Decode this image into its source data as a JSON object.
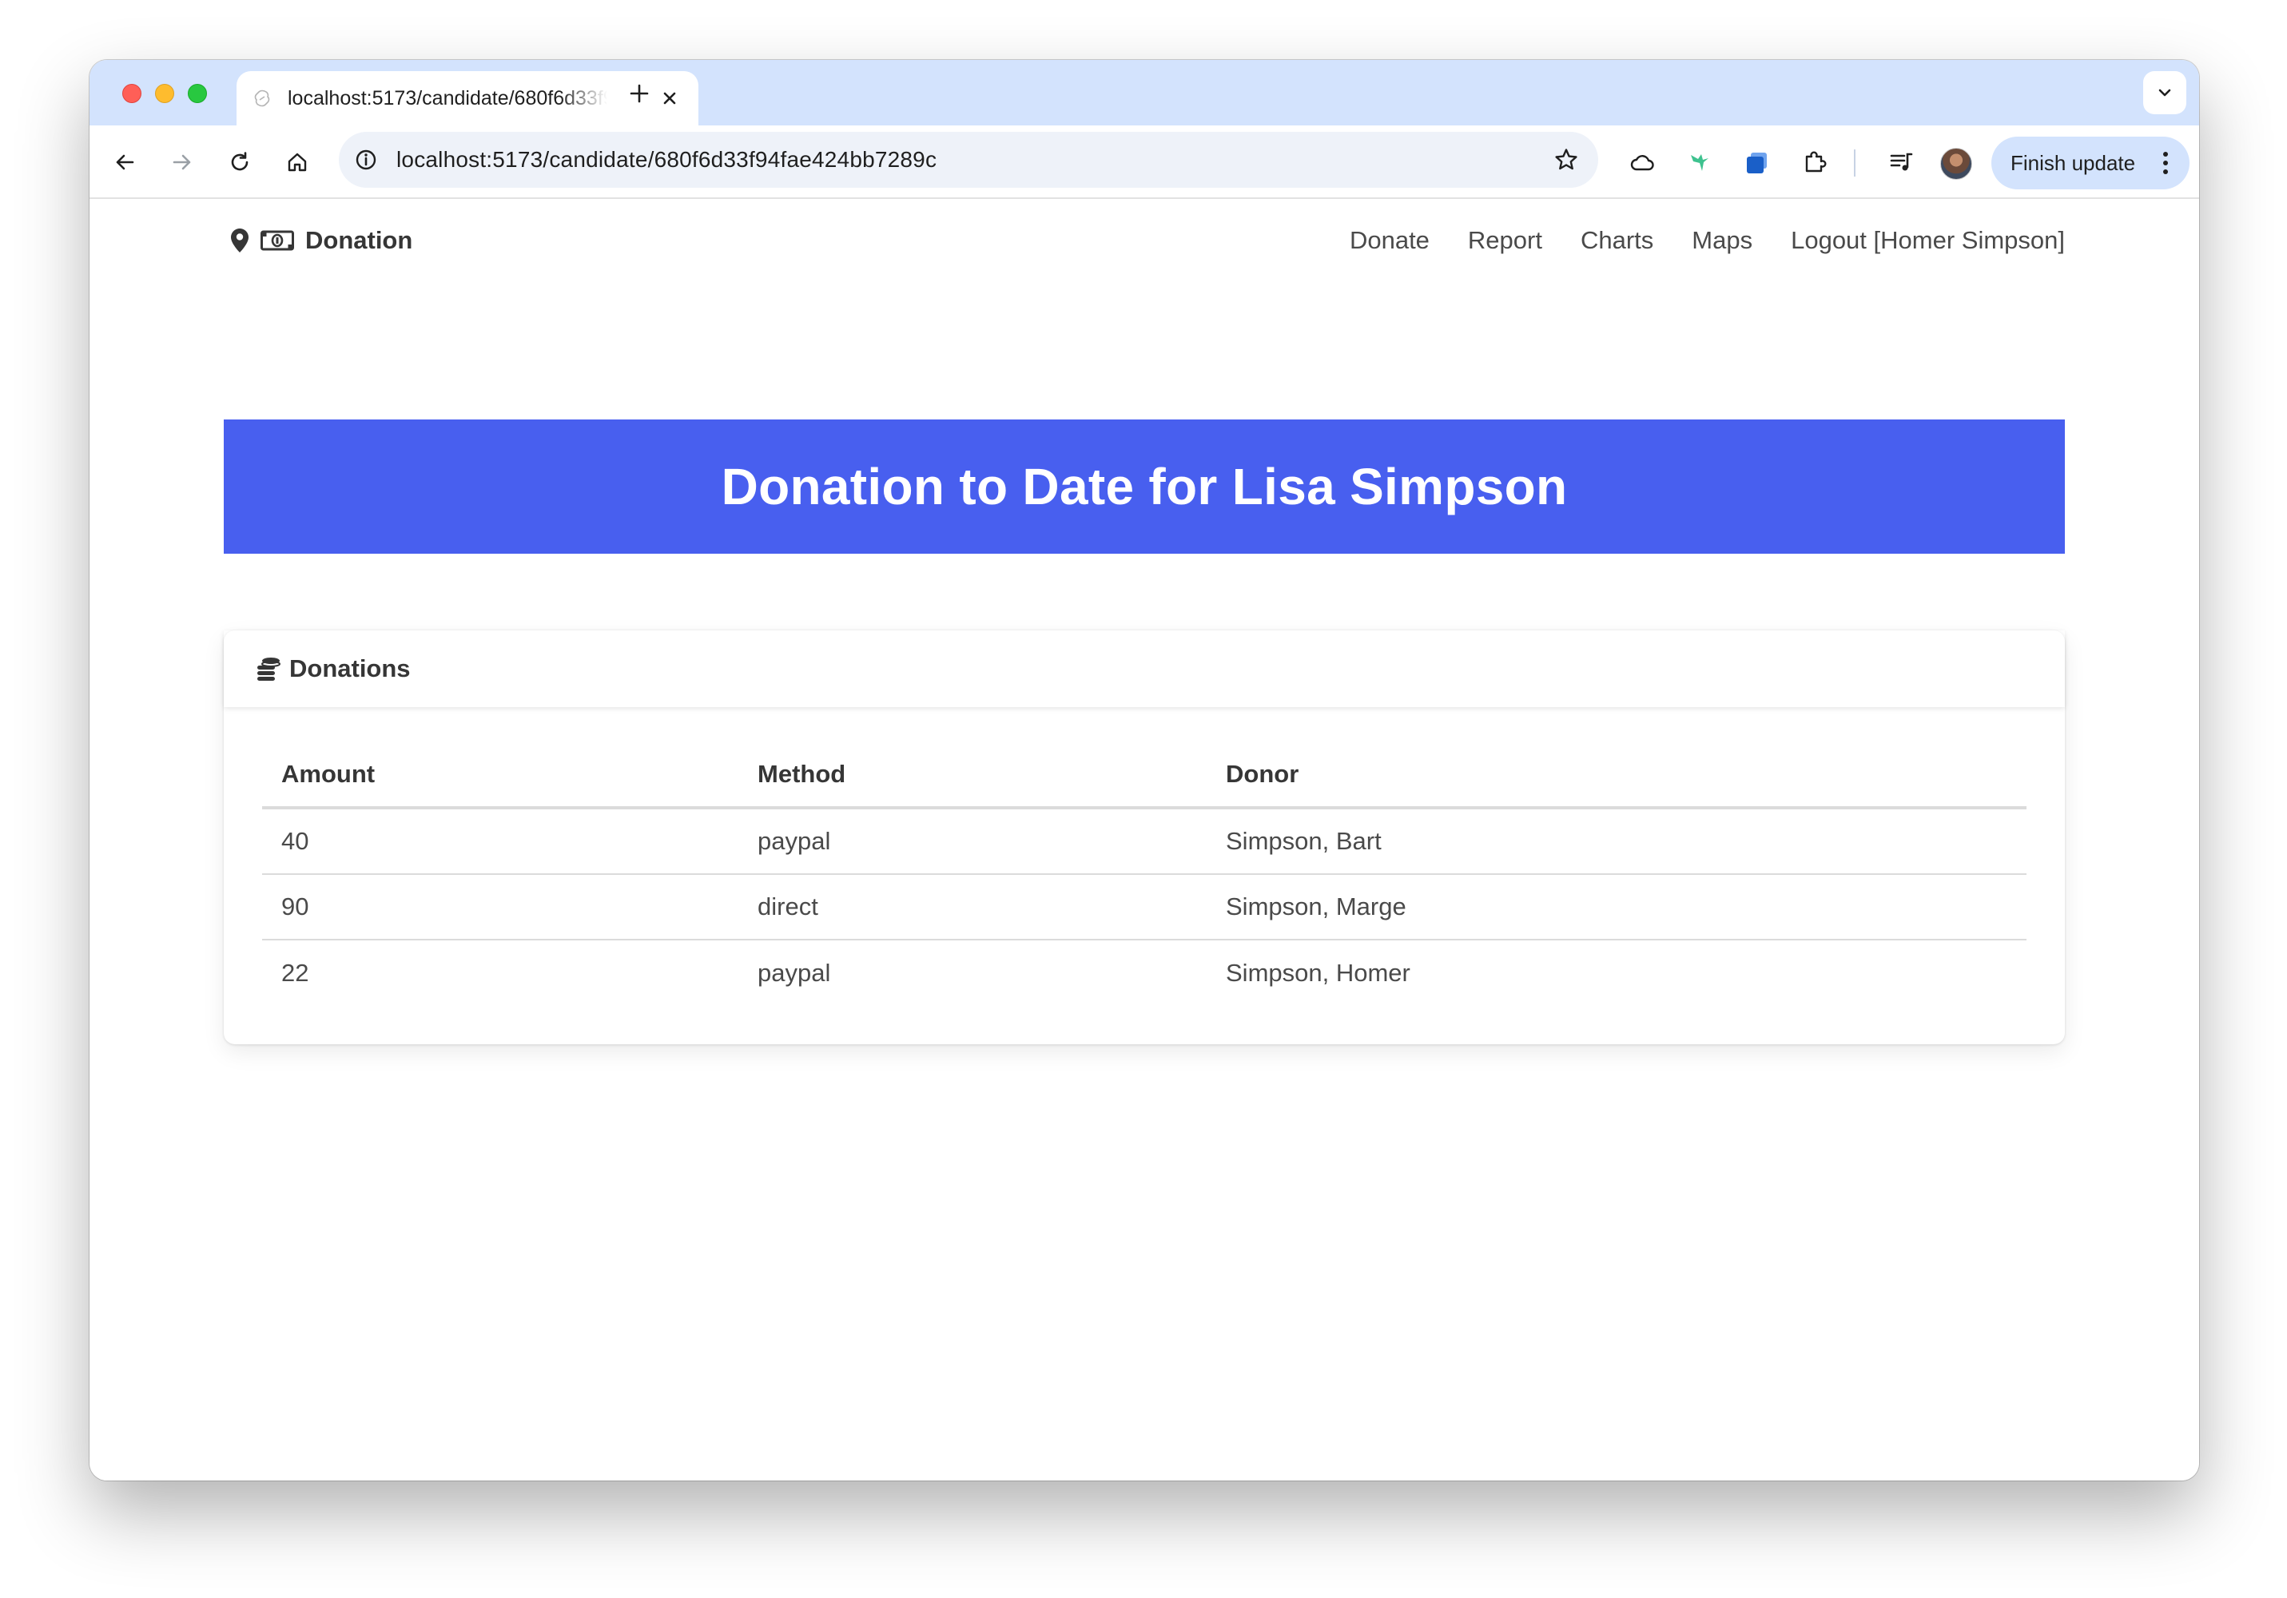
{
  "browser": {
    "tab_title": "localhost:5173/candidate/680f6d33f94fae424bb7289c",
    "url": "localhost:5173/candidate/680f6d33f94fae424bb7289c",
    "finish_update_label": "Finish update"
  },
  "navbar": {
    "brand": "Donation",
    "links": [
      "Donate",
      "Report",
      "Charts",
      "Maps",
      "Logout [Homer Simpson]"
    ]
  },
  "hero": {
    "title": "Donation to Date for Lisa Simpson",
    "color": "#485fef"
  },
  "donations": {
    "title": "Donations",
    "columns": [
      "Amount",
      "Method",
      "Donor"
    ],
    "rows": [
      {
        "amount": "40",
        "method": "paypal",
        "donor": "Simpson, Bart"
      },
      {
        "amount": "90",
        "method": "direct",
        "donor": "Simpson, Marge"
      },
      {
        "amount": "22",
        "method": "paypal",
        "donor": "Simpson, Homer"
      }
    ]
  }
}
